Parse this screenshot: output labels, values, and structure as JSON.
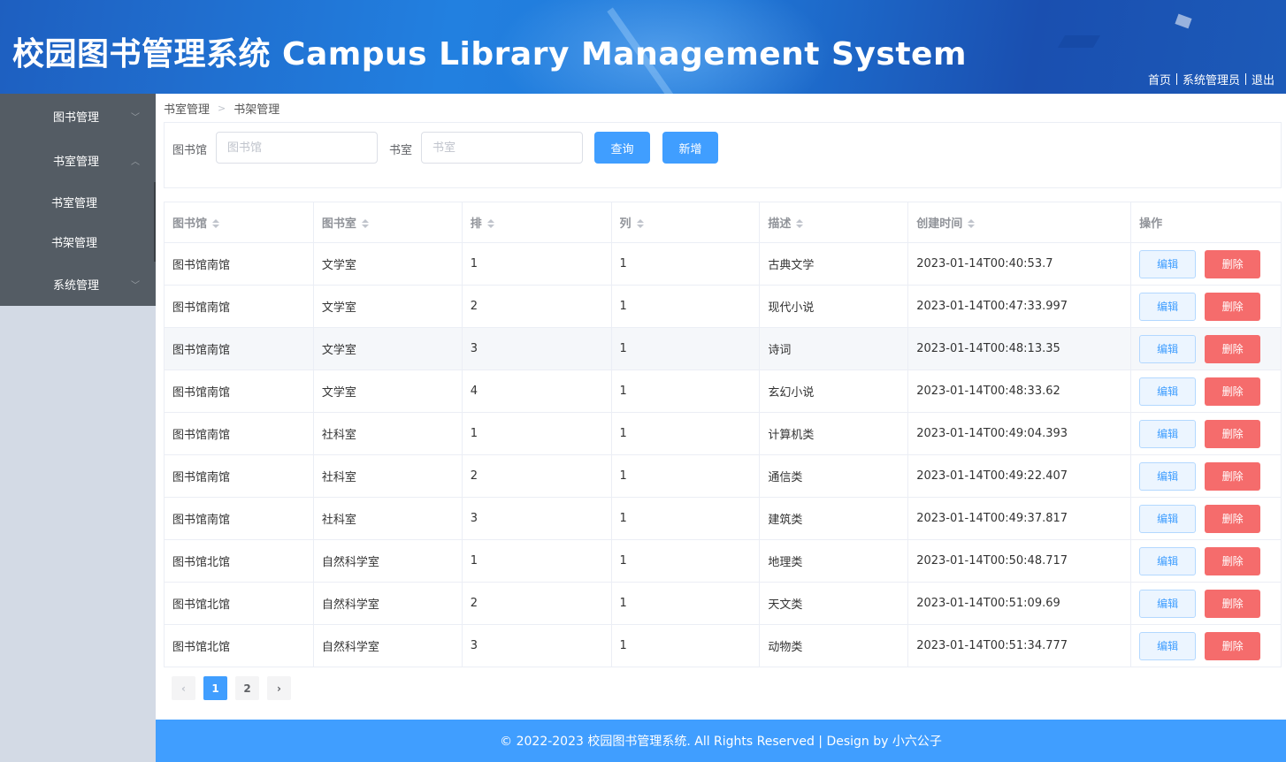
{
  "header": {
    "title": "校园图书管理系统 Campus Library Management System",
    "links": {
      "home": "首页",
      "user": "系统管理员",
      "logout": "退出"
    }
  },
  "sidebar": {
    "items": [
      {
        "label": "图书管理",
        "arrow": "﹀"
      },
      {
        "label": "书室管理",
        "arrow": "︿"
      },
      {
        "label": "系统管理",
        "arrow": "﹀"
      }
    ],
    "sub_items": [
      {
        "label": "书室管理"
      },
      {
        "label": "书架管理"
      }
    ]
  },
  "breadcrumb": {
    "items": [
      "书室管理",
      "书架管理"
    ],
    "separator": ">"
  },
  "search": {
    "library_label": "图书馆",
    "library_placeholder": "图书馆",
    "library_value": "",
    "room_label": "书室",
    "room_placeholder": "书室",
    "room_value": "",
    "query_button": "查询",
    "add_button": "新增"
  },
  "table": {
    "columns": [
      "图书馆",
      "图书室",
      "排",
      "列",
      "描述",
      "创建时间",
      "操作"
    ],
    "edit_label": "编辑",
    "delete_label": "删除",
    "rows": [
      [
        "图书馆南馆",
        "文学室",
        "1",
        "1",
        "古典文学",
        "2023-01-14T00:40:53.7"
      ],
      [
        "图书馆南馆",
        "文学室",
        "2",
        "1",
        "现代小说",
        "2023-01-14T00:47:33.997"
      ],
      [
        "图书馆南馆",
        "文学室",
        "3",
        "1",
        "诗词",
        "2023-01-14T00:48:13.35"
      ],
      [
        "图书馆南馆",
        "文学室",
        "4",
        "1",
        "玄幻小说",
        "2023-01-14T00:48:33.62"
      ],
      [
        "图书馆南馆",
        "社科室",
        "1",
        "1",
        "计算机类",
        "2023-01-14T00:49:04.393"
      ],
      [
        "图书馆南馆",
        "社科室",
        "2",
        "1",
        "通信类",
        "2023-01-14T00:49:22.407"
      ],
      [
        "图书馆南馆",
        "社科室",
        "3",
        "1",
        "建筑类",
        "2023-01-14T00:49:37.817"
      ],
      [
        "图书馆北馆",
        "自然科学室",
        "1",
        "1",
        "地理类",
        "2023-01-14T00:50:48.717"
      ],
      [
        "图书馆北馆",
        "自然科学室",
        "2",
        "1",
        "天文类",
        "2023-01-14T00:51:09.69"
      ],
      [
        "图书馆北馆",
        "自然科学室",
        "3",
        "1",
        "动物类",
        "2023-01-14T00:51:34.777"
      ]
    ]
  },
  "pagination": {
    "prev": "‹",
    "pages": [
      "1",
      "2"
    ],
    "next": "›",
    "current": "1"
  },
  "footer": {
    "text": "© 2022-2023 校园图书管理系统. All Rights Reserved | Design by 小六公子"
  },
  "colors": {
    "primary": "#409eff",
    "danger": "#f56c6c",
    "sidebar": "#545c64"
  }
}
